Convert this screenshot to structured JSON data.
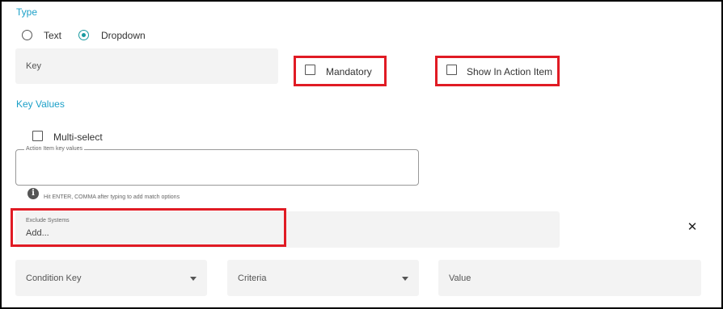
{
  "type_section": {
    "label": "Type",
    "options": [
      {
        "label": "Text",
        "selected": false
      },
      {
        "label": "Dropdown",
        "selected": true
      }
    ]
  },
  "key_field": {
    "placeholder": "Key"
  },
  "mandatory": {
    "label": "Mandatory",
    "checked": false
  },
  "show_in_action_item": {
    "label": "Show In Action Item",
    "checked": false
  },
  "key_values_section": {
    "label": "Key Values"
  },
  "multi_select": {
    "label": "Multi-select",
    "checked": false
  },
  "action_item_key_values": {
    "label": "Action Item key values",
    "value": ""
  },
  "hint": {
    "icon": "info-icon",
    "text": "Hit ENTER, COMMA after typing to add match options"
  },
  "exclude_systems": {
    "label": "Exclude Systems",
    "placeholder": "Add..."
  },
  "close": {
    "icon": "close-icon",
    "glyph": "✕"
  },
  "condition_row": {
    "condition_key": {
      "placeholder": "Condition Key"
    },
    "criteria": {
      "placeholder": "Criteria"
    },
    "value": {
      "placeholder": "Value"
    }
  },
  "colors": {
    "accent": "#1ca0c8",
    "radio_selected": "#1a9aa0",
    "highlight_red": "#e01b24",
    "field_bg": "#f3f3f3"
  }
}
